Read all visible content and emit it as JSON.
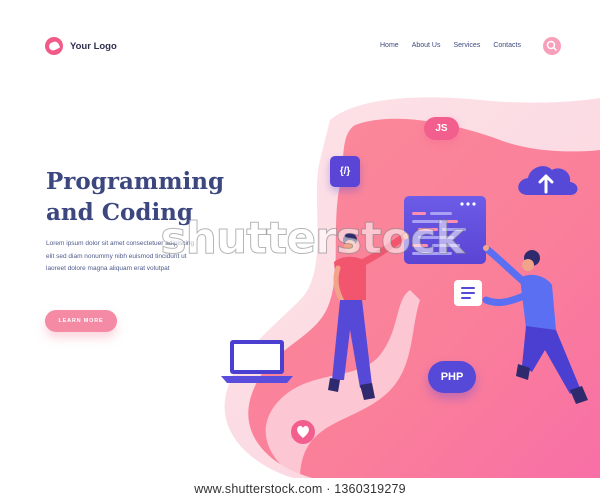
{
  "brand": {
    "logo_text": "Your Logo"
  },
  "nav": {
    "items": [
      {
        "label": "Home"
      },
      {
        "label": "About Us"
      },
      {
        "label": "Services"
      },
      {
        "label": "Contacts"
      }
    ]
  },
  "hero": {
    "title_line1": "Programming",
    "title_line2": "and Coding",
    "body": "Lorem ipsum dolor sit amet consectetuer adipiscing elit sed diam nonummy nibh euismod tincidunt ut laoreet dolore magna aliquam erat volutpat",
    "cta_label": "LEARN MORE"
  },
  "illustration": {
    "chips": {
      "js": "JS",
      "php": "PHP",
      "code": "{/}"
    }
  },
  "watermark": {
    "overlay": "shutterstock",
    "footer": "www.shutterstock.com · 1360319279"
  },
  "colors": {
    "accent_pink": "#f15b87",
    "accent_purple": "#5649d8",
    "title_navy": "#3c4780",
    "blob_pink": "#fb8f9c"
  },
  "icons": [
    "logo-mark",
    "search-icon",
    "cloud-upload-icon",
    "heart-icon",
    "laptop-icon",
    "document-icon",
    "code-window-icon"
  ]
}
